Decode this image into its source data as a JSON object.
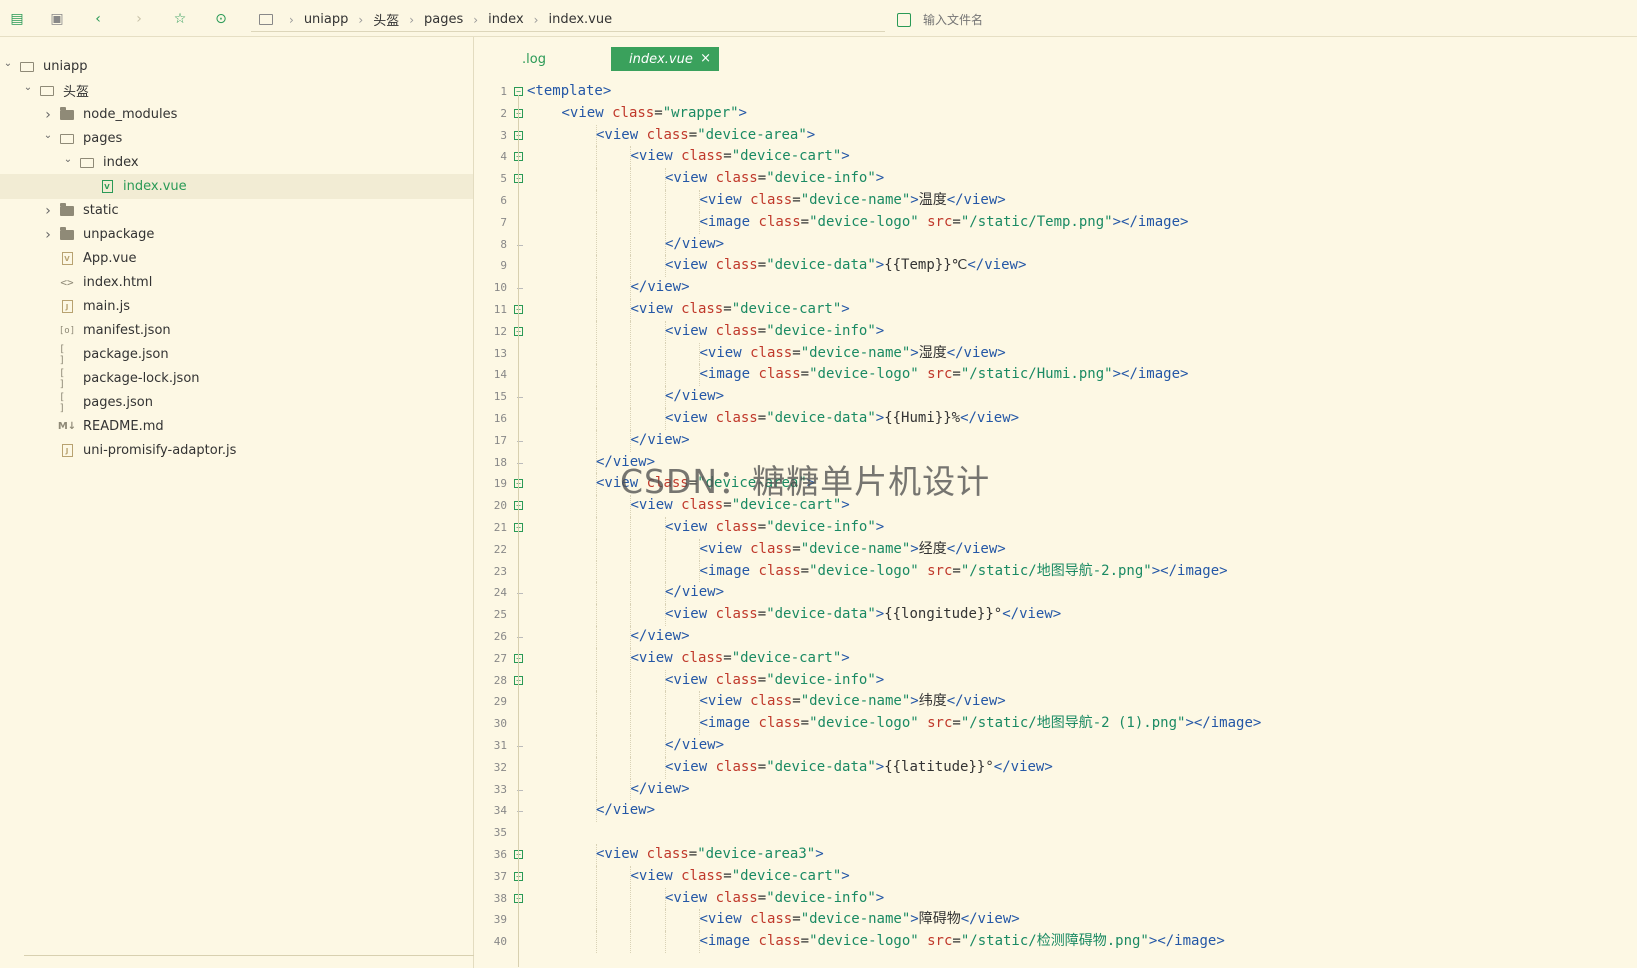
{
  "toolbar": {
    "icons": [
      "new-file-icon",
      "save-icon",
      "back-icon",
      "forward-icon",
      "star-icon",
      "run-icon"
    ],
    "breadcrumb": [
      "uniapp",
      "头盔",
      "pages",
      "index",
      "index.vue"
    ],
    "search_placeholder": "输入文件名"
  },
  "sidebar": {
    "items": [
      {
        "label": "uniapp",
        "indent": 0,
        "type": "folder-open",
        "chevron": "down"
      },
      {
        "label": "头盔",
        "indent": 1,
        "type": "folder-open",
        "chevron": "down"
      },
      {
        "label": "node_modules",
        "indent": 2,
        "type": "folder",
        "chevron": "right"
      },
      {
        "label": "pages",
        "indent": 2,
        "type": "folder-open",
        "chevron": "down"
      },
      {
        "label": "index",
        "indent": 3,
        "type": "folder-open",
        "chevron": "down"
      },
      {
        "label": "index.vue",
        "indent": 4,
        "type": "vue",
        "chevron": "",
        "selected": true
      },
      {
        "label": "static",
        "indent": 2,
        "type": "folder",
        "chevron": "right"
      },
      {
        "label": "unpackage",
        "indent": 2,
        "type": "folder",
        "chevron": "right"
      },
      {
        "label": "App.vue",
        "indent": 2,
        "type": "vue",
        "chevron": ""
      },
      {
        "label": "index.html",
        "indent": 2,
        "type": "html",
        "chevron": ""
      },
      {
        "label": "main.js",
        "indent": 2,
        "type": "js",
        "chevron": ""
      },
      {
        "label": "manifest.json",
        "indent": 2,
        "type": "manifest",
        "chevron": ""
      },
      {
        "label": "package.json",
        "indent": 2,
        "type": "json",
        "chevron": ""
      },
      {
        "label": "package-lock.json",
        "indent": 2,
        "type": "json",
        "chevron": ""
      },
      {
        "label": "pages.json",
        "indent": 2,
        "type": "json",
        "chevron": ""
      },
      {
        "label": "README.md",
        "indent": 2,
        "type": "md",
        "chevron": ""
      },
      {
        "label": "uni-promisify-adaptor.js",
        "indent": 2,
        "type": "js",
        "chevron": ""
      }
    ]
  },
  "tabs": {
    "log": ".log",
    "active": "index.vue",
    "close": "×"
  },
  "watermark": "CSDN：糖糖单片机设计",
  "code": [
    {
      "n": "1",
      "indent": 0,
      "fold": "box",
      "src": "<template>"
    },
    {
      "n": "2",
      "indent": 1,
      "fold": "box",
      "src": "<view class=\"wrapper\">"
    },
    {
      "n": "3",
      "indent": 2,
      "fold": "box",
      "src": "<view class=\"device-area\">"
    },
    {
      "n": "4",
      "indent": 3,
      "fold": "box",
      "src": "<view class=\"device-cart\">"
    },
    {
      "n": "5",
      "indent": 4,
      "fold": "box",
      "src": "<view class=\"device-info\">"
    },
    {
      "n": "6",
      "indent": 5,
      "fold": "",
      "src": "<view class=\"device-name\">温度</view>"
    },
    {
      "n": "7",
      "indent": 5,
      "fold": "",
      "src": "<image class=\"device-logo\" src=\"/static/Temp.png\"></image>"
    },
    {
      "n": "8",
      "indent": 4,
      "fold": "dash",
      "src": "</view>"
    },
    {
      "n": "9",
      "indent": 4,
      "fold": "",
      "src": "<view class=\"device-data\">{{Temp}}℃</view>"
    },
    {
      "n": "10",
      "indent": 3,
      "fold": "dash",
      "src": "</view>"
    },
    {
      "n": "11",
      "indent": 3,
      "fold": "box",
      "src": "<view class=\"device-cart\">"
    },
    {
      "n": "12",
      "indent": 4,
      "fold": "box",
      "src": "<view class=\"device-info\">"
    },
    {
      "n": "13",
      "indent": 5,
      "fold": "",
      "src": "<view class=\"device-name\">湿度</view>"
    },
    {
      "n": "14",
      "indent": 5,
      "fold": "",
      "src": "<image class=\"device-logo\" src=\"/static/Humi.png\"></image>"
    },
    {
      "n": "15",
      "indent": 4,
      "fold": "dash",
      "src": "</view>"
    },
    {
      "n": "16",
      "indent": 4,
      "fold": "",
      "src": "<view class=\"device-data\">{{Humi}}%</view>"
    },
    {
      "n": "17",
      "indent": 3,
      "fold": "dash",
      "src": "</view>"
    },
    {
      "n": "18",
      "indent": 2,
      "fold": "dash",
      "src": "</view>"
    },
    {
      "n": "19",
      "indent": 2,
      "fold": "box",
      "src": "<view class=\"device-area\">"
    },
    {
      "n": "20",
      "indent": 3,
      "fold": "box",
      "src": "<view class=\"device-cart\">"
    },
    {
      "n": "21",
      "indent": 4,
      "fold": "box",
      "src": "<view class=\"device-info\">"
    },
    {
      "n": "22",
      "indent": 5,
      "fold": "",
      "src": "<view class=\"device-name\">经度</view>"
    },
    {
      "n": "23",
      "indent": 5,
      "fold": "",
      "src": "<image class=\"device-logo\" src=\"/static/地图导航-2.png\"></image>"
    },
    {
      "n": "24",
      "indent": 4,
      "fold": "dash",
      "src": "</view>"
    },
    {
      "n": "25",
      "indent": 4,
      "fold": "",
      "src": "<view class=\"device-data\">{{longitude}}°</view>"
    },
    {
      "n": "26",
      "indent": 3,
      "fold": "dash",
      "src": "</view>"
    },
    {
      "n": "27",
      "indent": 3,
      "fold": "box",
      "src": "<view class=\"device-cart\">"
    },
    {
      "n": "28",
      "indent": 4,
      "fold": "box",
      "src": "<view class=\"device-info\">"
    },
    {
      "n": "29",
      "indent": 5,
      "fold": "",
      "src": "<view class=\"device-name\">纬度</view>"
    },
    {
      "n": "30",
      "indent": 5,
      "fold": "",
      "src": "<image class=\"device-logo\" src=\"/static/地图导航-2 (1).png\"></image>"
    },
    {
      "n": "31",
      "indent": 4,
      "fold": "dash",
      "src": "</view>"
    },
    {
      "n": "32",
      "indent": 4,
      "fold": "",
      "src": "<view class=\"device-data\">{{latitude}}°</view>"
    },
    {
      "n": "33",
      "indent": 3,
      "fold": "dash",
      "src": "</view>"
    },
    {
      "n": "34",
      "indent": 2,
      "fold": "dash",
      "src": "</view>"
    },
    {
      "n": "35",
      "indent": 0,
      "fold": "",
      "src": ""
    },
    {
      "n": "36",
      "indent": 2,
      "fold": "box",
      "src": "<view class=\"device-area3\">"
    },
    {
      "n": "37",
      "indent": 3,
      "fold": "box",
      "src": "<view class=\"device-cart\">"
    },
    {
      "n": "38",
      "indent": 4,
      "fold": "box",
      "src": "<view class=\"device-info\">"
    },
    {
      "n": "39",
      "indent": 5,
      "fold": "",
      "src": "<view class=\"device-name\">障碍物</view>"
    },
    {
      "n": "40",
      "indent": 5,
      "fold": "",
      "src": "<image class=\"device-logo\" src=\"/static/检测障碍物.png\"></image>"
    }
  ]
}
